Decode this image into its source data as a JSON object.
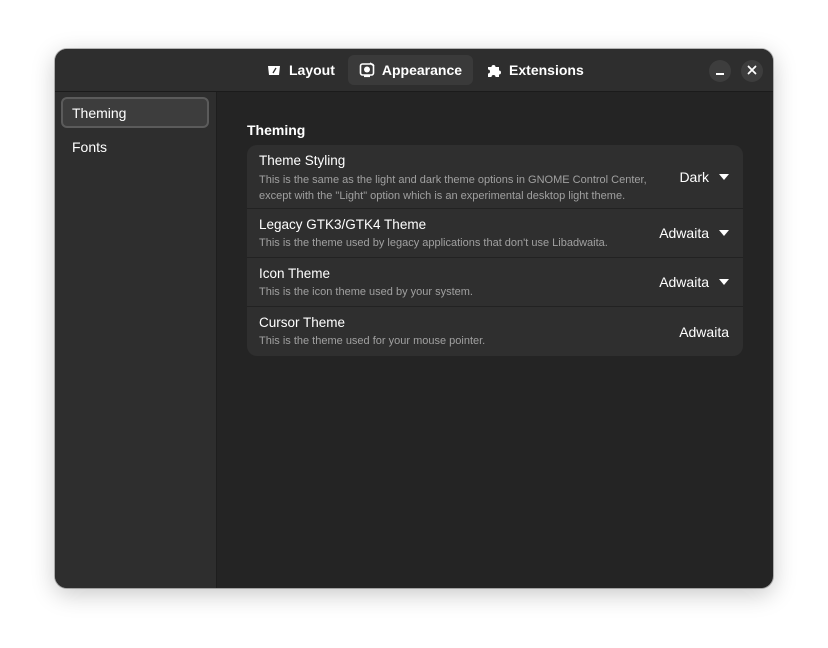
{
  "header": {
    "tabs": [
      {
        "label": "Layout",
        "icon": "layout-icon",
        "active": false
      },
      {
        "label": "Appearance",
        "icon": "appearance-icon",
        "active": true
      },
      {
        "label": "Extensions",
        "icon": "puzzle-icon",
        "active": false
      }
    ],
    "window_buttons": [
      "minimize-icon",
      "close-icon"
    ]
  },
  "sidebar": {
    "items": [
      {
        "label": "Theming",
        "selected": true
      },
      {
        "label": "Fonts",
        "selected": false
      }
    ]
  },
  "main": {
    "section_title": "Theming",
    "rows": [
      {
        "title": "Theme Styling",
        "subtitle_line1": "This is the same as the light and dark theme options in GNOME Control Center,",
        "subtitle_line2": "except with the \"Light\" option which is an experimental desktop light theme.",
        "value": "Dark",
        "dropdown": true
      },
      {
        "title": "Legacy GTK3/GTK4 Theme",
        "subtitle": "This is the theme used by legacy applications that don't use Libadwaita.",
        "value": "Adwaita",
        "dropdown": true
      },
      {
        "title": "Icon Theme",
        "subtitle": "This is the icon theme used by your system.",
        "value": "Adwaita",
        "dropdown": true
      },
      {
        "title": "Cursor Theme",
        "subtitle": "This is the theme used for your mouse pointer.",
        "value": "Adwaita",
        "dropdown": false
      }
    ]
  },
  "colors": {
    "window_bg": "#242424",
    "headerbar_bg": "#2e2e2e",
    "row_bg": "#2f2f2f",
    "subtitle_text": "#a0a0a0"
  }
}
